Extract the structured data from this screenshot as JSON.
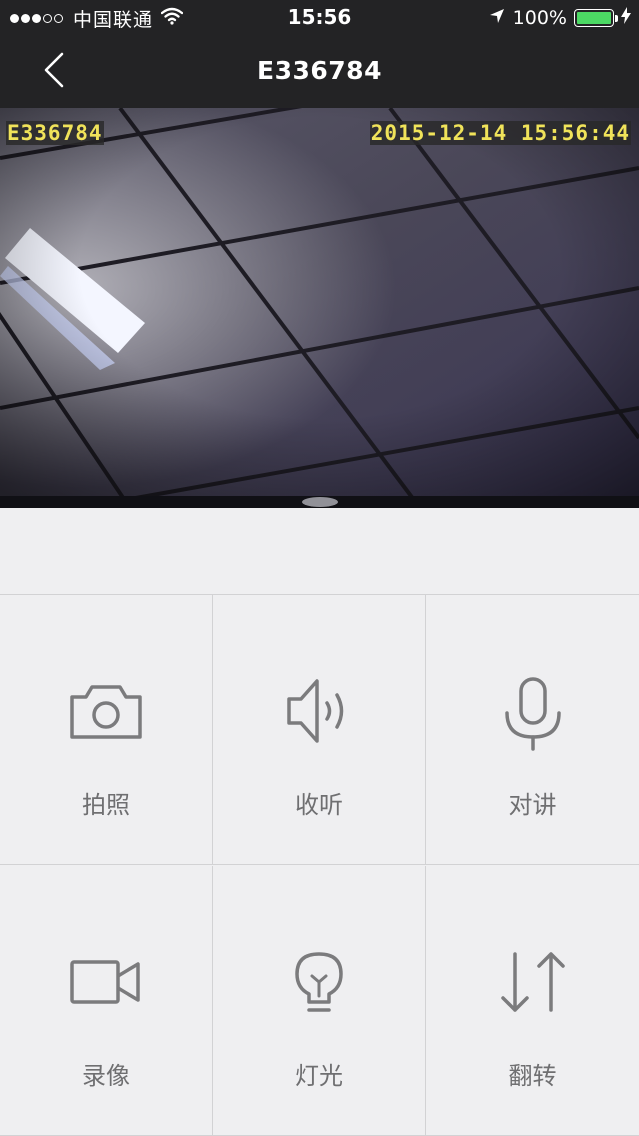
{
  "status_bar": {
    "carrier": "中国联通",
    "time": "15:56",
    "battery_text": "100%",
    "signal_bars": 3,
    "signal_total": 5,
    "battery_level": 1.0,
    "battery_color": "#4cd964"
  },
  "nav": {
    "title": "E336784",
    "back_icon": "chevron-left-icon"
  },
  "video": {
    "overlay_id": "E336784",
    "overlay_timestamp": "2015-12-14 15:56:44"
  },
  "controls": [
    {
      "label": "拍照",
      "icon": "camera-icon"
    },
    {
      "label": "收听",
      "icon": "speaker-icon"
    },
    {
      "label": "对讲",
      "icon": "microphone-icon"
    },
    {
      "label": "录像",
      "icon": "video-camera-icon"
    },
    {
      "label": "灯光",
      "icon": "lightbulb-icon"
    },
    {
      "label": "翻转",
      "icon": "flip-arrows-icon"
    }
  ],
  "colors": {
    "bar_background": "#232325",
    "page_background": "#efeff1",
    "icon_color": "#7b7b7d",
    "osd_text": "#f0e35a"
  }
}
